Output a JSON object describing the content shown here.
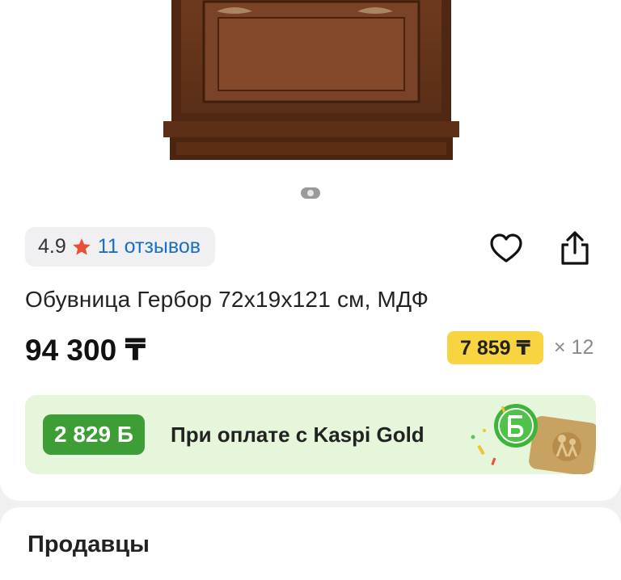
{
  "product": {
    "rating": "4.9",
    "reviews_label": "11 отзывов",
    "title": "Обувница Гербор 72x19x121 см, МДФ",
    "price": "94 300 ₸",
    "installment_amount": "7 859 ₸",
    "installment_multiplier": "× 12"
  },
  "bonus": {
    "amount": "2 829 Б",
    "text": "При оплате с Kaspi Gold"
  },
  "sellers": {
    "title": "Продавцы"
  },
  "gallery": {
    "active_index": 1,
    "total": 1
  },
  "colors": {
    "accent_star": "#e8503a",
    "link": "#1a6fc4",
    "installment_bg": "#f8d540",
    "bonus_bg": "#e5f6da",
    "bonus_pill": "#3d9e35"
  },
  "icons": {
    "favorite": "heart-icon",
    "share": "share-icon",
    "rating": "star-icon"
  }
}
